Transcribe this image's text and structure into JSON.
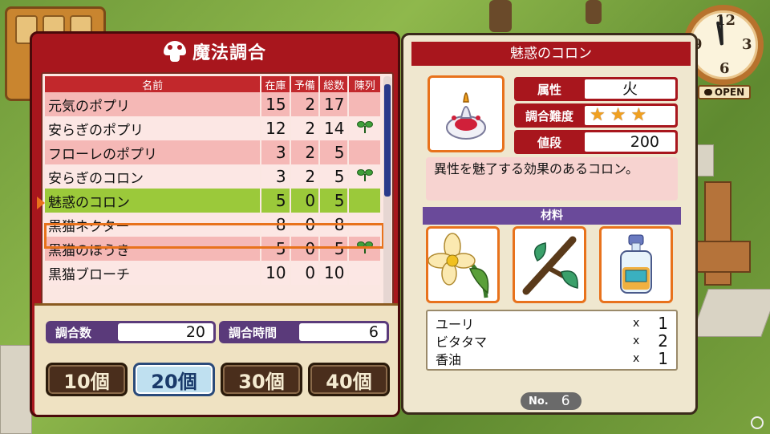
{
  "clock": {
    "numbers": [
      "12",
      "3",
      "6",
      "9"
    ],
    "open_label": "OPEN"
  },
  "recipe_panel": {
    "title": "魔法調合",
    "columns": [
      "名前",
      "在庫",
      "予備",
      "総数",
      "陳列"
    ],
    "rows": [
      {
        "name": "元気のポプリ",
        "stock": "15",
        "reserve": "2",
        "total": "17",
        "displayed": false
      },
      {
        "name": "安らぎのポプリ",
        "stock": "12",
        "reserve": "2",
        "total": "14",
        "displayed": true
      },
      {
        "name": "フローレのポプリ",
        "stock": "3",
        "reserve": "2",
        "total": "5",
        "displayed": false
      },
      {
        "name": "安らぎのコロン",
        "stock": "3",
        "reserve": "2",
        "total": "5",
        "displayed": true
      },
      {
        "name": "魅惑のコロン",
        "stock": "5",
        "reserve": "0",
        "total": "5",
        "displayed": false,
        "selected": true
      },
      {
        "name": "黒猫ネクター",
        "stock": "8",
        "reserve": "0",
        "total": "8",
        "displayed": false
      },
      {
        "name": "黒猫のほうき",
        "stock": "5",
        "reserve": "0",
        "total": "5",
        "displayed": true
      },
      {
        "name": "黒猫ブローチ",
        "stock": "10",
        "reserve": "0",
        "total": "10",
        "displayed": false
      }
    ],
    "scroll_position": 0.0,
    "count_label": "調合数",
    "count_value": "20",
    "time_label": "調合時間",
    "time_value": "6",
    "quantity_buttons": [
      {
        "label": "10個",
        "active": false
      },
      {
        "label": "20個",
        "active": true
      },
      {
        "label": "30個",
        "active": false
      },
      {
        "label": "40個",
        "active": false
      }
    ]
  },
  "detail_panel": {
    "title": "魅惑のコロン",
    "attribute_label": "属性",
    "attribute_value": "火",
    "difficulty_label": "調合難度",
    "difficulty_stars": 3,
    "price_label": "値段",
    "price_value": "200",
    "description": "異性を魅了する効果のあるコロン。",
    "materials_label": "材料",
    "materials": [
      {
        "name": "ユーリ",
        "x": "x",
        "qty": "1"
      },
      {
        "name": "ビタタマ",
        "x": "x",
        "qty": "2"
      },
      {
        "name": "香油",
        "x": "x",
        "qty": "1"
      }
    ],
    "no_label": "No.",
    "no_value": "6"
  },
  "colors": {
    "panel_red": "#a8161d",
    "header_purple": "#6a4a9a",
    "selection_green": "#9bc93a",
    "highlight_orange": "#e8721c"
  },
  "icons": [
    "mushroom-icon",
    "sprout-icon",
    "star-icon",
    "cursor-arrow-icon",
    "clock-icon"
  ]
}
